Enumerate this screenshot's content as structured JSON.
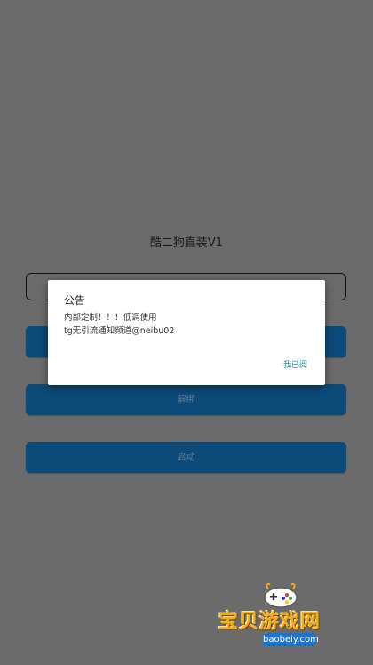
{
  "app": {
    "title": "酷二狗直装V1"
  },
  "form": {
    "input_value": ""
  },
  "buttons": {
    "login_label": "",
    "unbind_label": "解绑",
    "start_label": "启动"
  },
  "dialog": {
    "title": "公告",
    "lines": [
      "内部定制！！！低调使用",
      "tg无引流通知频道@neibu02"
    ],
    "ok_label": "我已阅"
  },
  "watermark": {
    "brand": "宝贝游戏网",
    "url": "baobeiy.com"
  },
  "colors": {
    "background": "#6b6b6b",
    "button": "#0c4a79",
    "dialog_action": "#1a8a8a",
    "watermark": "#f3ad1c"
  }
}
